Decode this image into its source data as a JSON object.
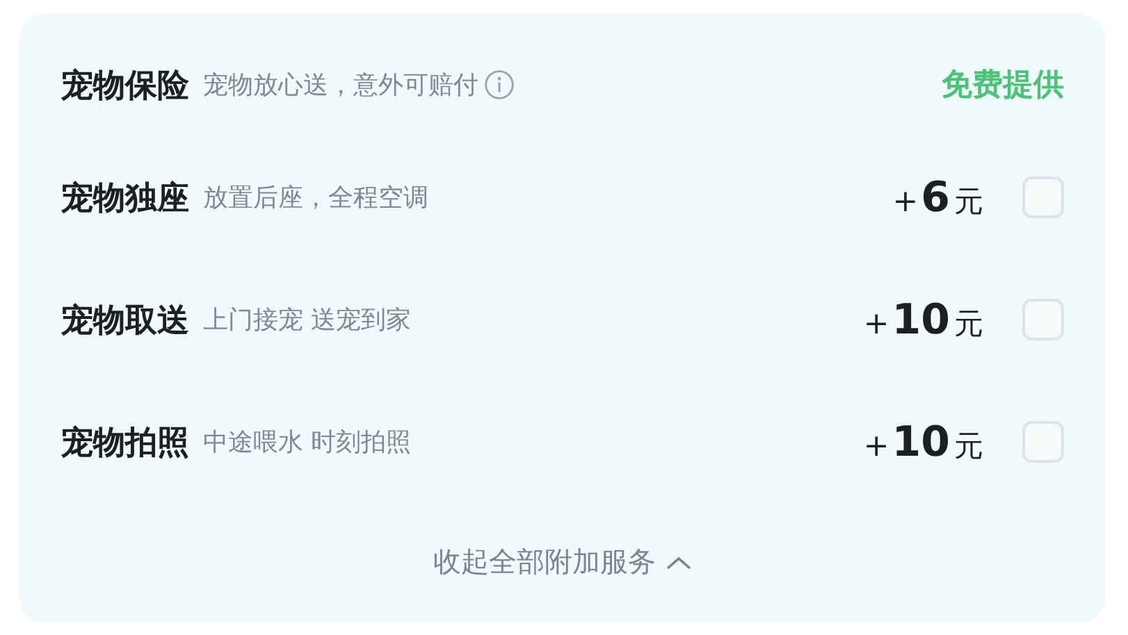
{
  "services": [
    {
      "kind": "free",
      "title": "宠物保险",
      "description": "宠物放心送，意外可赔付",
      "info": true,
      "price_label": "免费提供"
    },
    {
      "kind": "paid",
      "title": "宠物独座",
      "description": "放置后座，全程空调",
      "sign": "+",
      "amount": "6",
      "unit": "元",
      "checked": false
    },
    {
      "kind": "paid",
      "title": "宠物取送",
      "description": "上门接宠 送宠到家",
      "sign": "+",
      "amount": "10",
      "unit": "元",
      "checked": false
    },
    {
      "kind": "paid",
      "title": "宠物拍照",
      "description": "中途喂水 时刻拍照",
      "sign": "+",
      "amount": "10",
      "unit": "元",
      "checked": false
    }
  ],
  "collapse_link": "收起全部附加服务"
}
